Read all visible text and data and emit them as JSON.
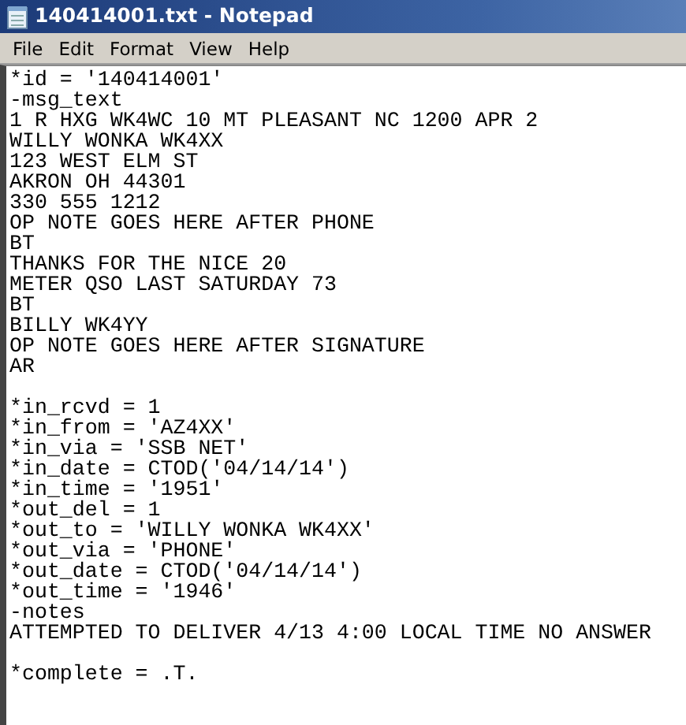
{
  "window": {
    "title": "140414001.txt - Notepad"
  },
  "menu": [
    {
      "label": "File"
    },
    {
      "label": "Edit"
    },
    {
      "label": "Format"
    },
    {
      "label": "View"
    },
    {
      "label": "Help"
    }
  ],
  "document": {
    "lines": [
      {
        "kind": "text",
        "text": "*id = '140414001'"
      },
      {
        "kind": "text",
        "text": "-msg_text"
      },
      {
        "kind": "text",
        "text": "1 R HXG WK4WC 10 MT PLEASANT NC 1200 APR 2"
      },
      {
        "kind": "text",
        "text": "WILLY WONKA WK4XX"
      },
      {
        "kind": "text",
        "text": "123 WEST ELM ST"
      },
      {
        "kind": "text",
        "text": "AKRON OH 44301"
      },
      {
        "kind": "text",
        "text": "330 555 1212"
      },
      {
        "kind": "text",
        "text": "OP NOTE GOES HERE AFTER PHONE"
      },
      {
        "kind": "text",
        "text": "BT"
      },
      {
        "kind": "text",
        "text": "THANKS FOR THE NICE 20"
      },
      {
        "kind": "text",
        "text": "METER QSO LAST SATURDAY 73"
      },
      {
        "kind": "text",
        "text": "BT"
      },
      {
        "kind": "text",
        "text": "BILLY WK4YY"
      },
      {
        "kind": "text",
        "text": "OP NOTE GOES HERE AFTER SIGNATURE"
      },
      {
        "kind": "text",
        "text": "AR"
      },
      {
        "kind": "blank"
      },
      {
        "kind": "text",
        "text": "*in_rcvd = 1"
      },
      {
        "kind": "text",
        "text": "*in_from = 'AZ4XX'"
      },
      {
        "kind": "text",
        "text": "*in_via = 'SSB NET'"
      },
      {
        "kind": "text",
        "text": "*in_date = CTOD('04/14/14')"
      },
      {
        "kind": "text",
        "text": "*in_time = '1951'"
      },
      {
        "kind": "text",
        "text": "*out_del = 1"
      },
      {
        "kind": "text",
        "text": "*out_to = 'WILLY WONKA WK4XX'"
      },
      {
        "kind": "text",
        "text": "*out_via = 'PHONE'"
      },
      {
        "kind": "text",
        "text": "*out_date = CTOD('04/14/14')"
      },
      {
        "kind": "text",
        "text": "*out_time = '1946'"
      },
      {
        "kind": "text",
        "text": "-notes"
      },
      {
        "kind": "text",
        "text": "ATTEMPTED TO DELIVER 4/13 4:00 LOCAL TIME NO ANSWER"
      },
      {
        "kind": "blank"
      },
      {
        "kind": "text",
        "text": "*complete = .T."
      }
    ]
  }
}
